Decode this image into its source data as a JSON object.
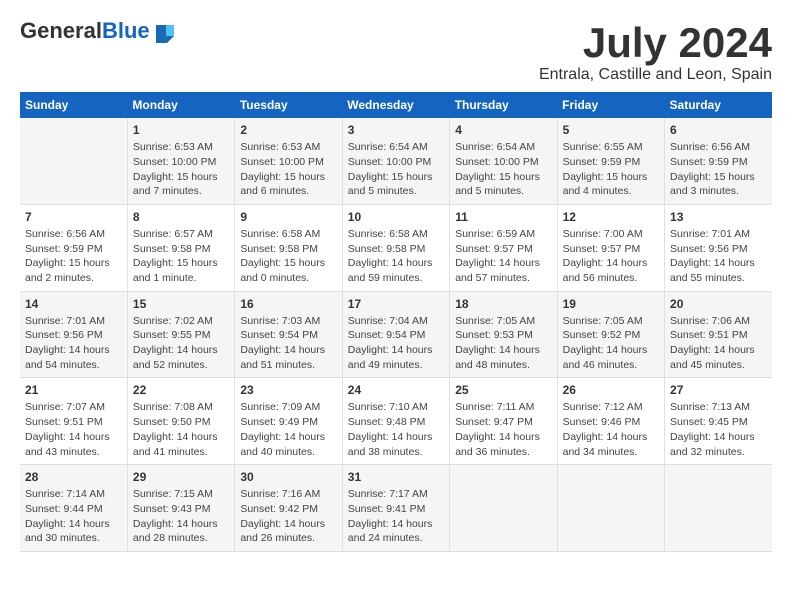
{
  "logo": {
    "text_general": "General",
    "text_blue": "Blue"
  },
  "title": "July 2024",
  "subtitle": "Entrala, Castille and Leon, Spain",
  "calendar": {
    "headers": [
      "Sunday",
      "Monday",
      "Tuesday",
      "Wednesday",
      "Thursday",
      "Friday",
      "Saturday"
    ],
    "weeks": [
      [
        {
          "day": "",
          "info": ""
        },
        {
          "day": "1",
          "info": "Sunrise: 6:53 AM\nSunset: 10:00 PM\nDaylight: 15 hours\nand 7 minutes."
        },
        {
          "day": "2",
          "info": "Sunrise: 6:53 AM\nSunset: 10:00 PM\nDaylight: 15 hours\nand 6 minutes."
        },
        {
          "day": "3",
          "info": "Sunrise: 6:54 AM\nSunset: 10:00 PM\nDaylight: 15 hours\nand 5 minutes."
        },
        {
          "day": "4",
          "info": "Sunrise: 6:54 AM\nSunset: 10:00 PM\nDaylight: 15 hours\nand 5 minutes."
        },
        {
          "day": "5",
          "info": "Sunrise: 6:55 AM\nSunset: 9:59 PM\nDaylight: 15 hours\nand 4 minutes."
        },
        {
          "day": "6",
          "info": "Sunrise: 6:56 AM\nSunset: 9:59 PM\nDaylight: 15 hours\nand 3 minutes."
        }
      ],
      [
        {
          "day": "7",
          "info": "Sunrise: 6:56 AM\nSunset: 9:59 PM\nDaylight: 15 hours\nand 2 minutes."
        },
        {
          "day": "8",
          "info": "Sunrise: 6:57 AM\nSunset: 9:58 PM\nDaylight: 15 hours\nand 1 minute."
        },
        {
          "day": "9",
          "info": "Sunrise: 6:58 AM\nSunset: 9:58 PM\nDaylight: 15 hours\nand 0 minutes."
        },
        {
          "day": "10",
          "info": "Sunrise: 6:58 AM\nSunset: 9:58 PM\nDaylight: 14 hours\nand 59 minutes."
        },
        {
          "day": "11",
          "info": "Sunrise: 6:59 AM\nSunset: 9:57 PM\nDaylight: 14 hours\nand 57 minutes."
        },
        {
          "day": "12",
          "info": "Sunrise: 7:00 AM\nSunset: 9:57 PM\nDaylight: 14 hours\nand 56 minutes."
        },
        {
          "day": "13",
          "info": "Sunrise: 7:01 AM\nSunset: 9:56 PM\nDaylight: 14 hours\nand 55 minutes."
        }
      ],
      [
        {
          "day": "14",
          "info": "Sunrise: 7:01 AM\nSunset: 9:56 PM\nDaylight: 14 hours\nand 54 minutes."
        },
        {
          "day": "15",
          "info": "Sunrise: 7:02 AM\nSunset: 9:55 PM\nDaylight: 14 hours\nand 52 minutes."
        },
        {
          "day": "16",
          "info": "Sunrise: 7:03 AM\nSunset: 9:54 PM\nDaylight: 14 hours\nand 51 minutes."
        },
        {
          "day": "17",
          "info": "Sunrise: 7:04 AM\nSunset: 9:54 PM\nDaylight: 14 hours\nand 49 minutes."
        },
        {
          "day": "18",
          "info": "Sunrise: 7:05 AM\nSunset: 9:53 PM\nDaylight: 14 hours\nand 48 minutes."
        },
        {
          "day": "19",
          "info": "Sunrise: 7:05 AM\nSunset: 9:52 PM\nDaylight: 14 hours\nand 46 minutes."
        },
        {
          "day": "20",
          "info": "Sunrise: 7:06 AM\nSunset: 9:51 PM\nDaylight: 14 hours\nand 45 minutes."
        }
      ],
      [
        {
          "day": "21",
          "info": "Sunrise: 7:07 AM\nSunset: 9:51 PM\nDaylight: 14 hours\nand 43 minutes."
        },
        {
          "day": "22",
          "info": "Sunrise: 7:08 AM\nSunset: 9:50 PM\nDaylight: 14 hours\nand 41 minutes."
        },
        {
          "day": "23",
          "info": "Sunrise: 7:09 AM\nSunset: 9:49 PM\nDaylight: 14 hours\nand 40 minutes."
        },
        {
          "day": "24",
          "info": "Sunrise: 7:10 AM\nSunset: 9:48 PM\nDaylight: 14 hours\nand 38 minutes."
        },
        {
          "day": "25",
          "info": "Sunrise: 7:11 AM\nSunset: 9:47 PM\nDaylight: 14 hours\nand 36 minutes."
        },
        {
          "day": "26",
          "info": "Sunrise: 7:12 AM\nSunset: 9:46 PM\nDaylight: 14 hours\nand 34 minutes."
        },
        {
          "day": "27",
          "info": "Sunrise: 7:13 AM\nSunset: 9:45 PM\nDaylight: 14 hours\nand 32 minutes."
        }
      ],
      [
        {
          "day": "28",
          "info": "Sunrise: 7:14 AM\nSunset: 9:44 PM\nDaylight: 14 hours\nand 30 minutes."
        },
        {
          "day": "29",
          "info": "Sunrise: 7:15 AM\nSunset: 9:43 PM\nDaylight: 14 hours\nand 28 minutes."
        },
        {
          "day": "30",
          "info": "Sunrise: 7:16 AM\nSunset: 9:42 PM\nDaylight: 14 hours\nand 26 minutes."
        },
        {
          "day": "31",
          "info": "Sunrise: 7:17 AM\nSunset: 9:41 PM\nDaylight: 14 hours\nand 24 minutes."
        },
        {
          "day": "",
          "info": ""
        },
        {
          "day": "",
          "info": ""
        },
        {
          "day": "",
          "info": ""
        }
      ]
    ]
  }
}
